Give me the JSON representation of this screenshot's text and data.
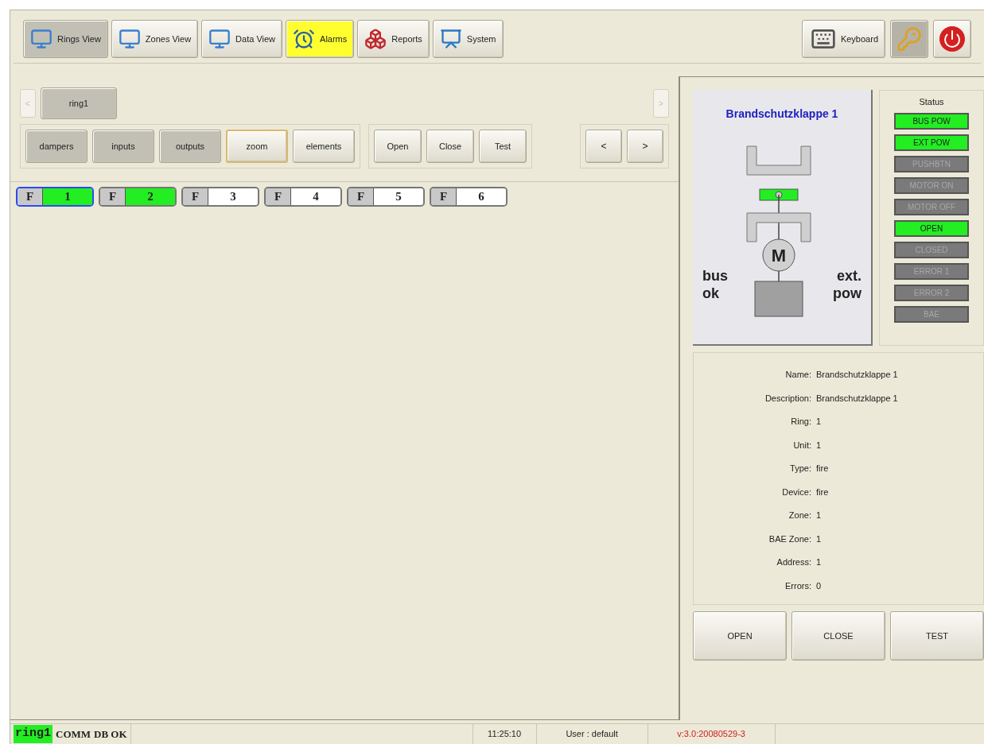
{
  "nav_tabs": [
    {
      "label": "Rings View",
      "kind": "monitor",
      "selected": true,
      "alert": false
    },
    {
      "label": "Zones View",
      "kind": "monitor",
      "selected": false,
      "alert": false
    },
    {
      "label": "Data View",
      "kind": "monitor",
      "selected": false,
      "alert": false
    },
    {
      "label": "Alarms",
      "kind": "clock",
      "selected": false,
      "alert": true
    },
    {
      "label": "Reports",
      "kind": "boxes",
      "selected": false,
      "alert": false
    },
    {
      "label": "System",
      "kind": "frame",
      "selected": false,
      "alert": false
    }
  ],
  "tools": [
    {
      "kind": "keyboard",
      "label": "Keyboard",
      "selected": false
    },
    {
      "kind": "keys",
      "selected": true
    },
    {
      "kind": "power",
      "selected": false
    }
  ],
  "ring_nav": {
    "prev": "<",
    "next": ">",
    "rings": [
      {
        "label": "ring1",
        "selected": true
      }
    ]
  },
  "view_buttons": [
    {
      "label": "dampers",
      "selected": true,
      "focused": false
    },
    {
      "label": "inputs",
      "selected": true,
      "focused": false
    },
    {
      "label": "outputs",
      "selected": true,
      "focused": false
    },
    {
      "label": "zoom",
      "selected": false,
      "focused": true
    },
    {
      "label": "elements",
      "selected": false,
      "focused": false
    }
  ],
  "action_buttons": [
    "Open",
    "Close",
    "Test"
  ],
  "page_buttons": [
    "<",
    ">"
  ],
  "dampers": [
    {
      "prefix": "F",
      "number": "1",
      "active": true,
      "selected": true
    },
    {
      "prefix": "F",
      "number": "2",
      "active": true,
      "selected": false
    },
    {
      "prefix": "F",
      "number": "3",
      "active": false,
      "selected": false
    },
    {
      "prefix": "F",
      "number": "4",
      "active": false,
      "selected": false
    },
    {
      "prefix": "F",
      "number": "5",
      "active": false,
      "selected": false
    },
    {
      "prefix": "F",
      "number": "6",
      "active": false,
      "selected": false
    }
  ],
  "device": {
    "title": "Brandschutzklappe 1",
    "flap_open": true,
    "motor": "M",
    "left_label": "bus ok",
    "right_label": "ext. pow"
  },
  "status": {
    "title": "Status",
    "items": [
      {
        "label": "BUS POW",
        "on": true
      },
      {
        "label": "EXT POW",
        "on": true
      },
      {
        "label": "PUSHBTN",
        "on": false
      },
      {
        "label": "MOTOR ON",
        "on": false
      },
      {
        "label": "MOTOR OFF",
        "on": false
      },
      {
        "label": "OPEN",
        "on": true
      },
      {
        "label": "CLOSED",
        "on": false
      },
      {
        "label": "ERROR 1",
        "on": false
      },
      {
        "label": "ERROR 2",
        "on": false
      },
      {
        "label": "BAE",
        "on": false
      }
    ]
  },
  "details": [
    {
      "label": "Name:",
      "value": "Brandschutzklappe 1"
    },
    {
      "label": "Description:",
      "value": "Brandschutzklappe 1"
    },
    {
      "label": "Ring:",
      "value": "1"
    },
    {
      "label": "Unit:",
      "value": "1"
    },
    {
      "label": "Type:",
      "value": "fire"
    },
    {
      "label": "Device:",
      "value": "fire"
    },
    {
      "label": "Zone:",
      "value": "1"
    },
    {
      "label": "BAE Zone:",
      "value": "1"
    },
    {
      "label": "Address:",
      "value": "1"
    },
    {
      "label": "Errors:",
      "value": "0"
    }
  ],
  "device_buttons": [
    "OPEN",
    "CLOSE",
    "TEST"
  ],
  "status_bar": {
    "ring": "ring1",
    "ring_ok": true,
    "comm": "COMM",
    "db": "DB OK",
    "time": "11:25:10",
    "user": "User : default",
    "version": "v:3.0:20080529-3"
  }
}
